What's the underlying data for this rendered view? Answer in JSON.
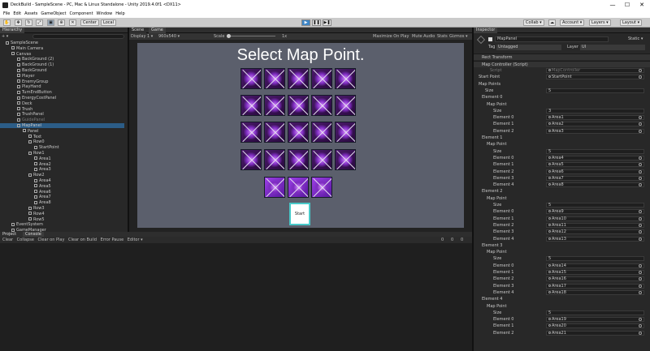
{
  "window": {
    "title": "DeckBuild - SampleScene - PC, Mac & Linux Standalone - Unity 2019.4.0f1 <DX11>",
    "controls": [
      "—",
      "☐",
      "✕"
    ]
  },
  "menu": [
    "File",
    "Edit",
    "Assets",
    "GameObject",
    "Component",
    "Window",
    "Help"
  ],
  "toolbar": {
    "pivot": "Center",
    "space": "Local",
    "collab": "Collab ▾",
    "account": "Account ▾",
    "layers": "Layers ▾",
    "layout": "Layout ▾"
  },
  "hierarchy": {
    "tab": "Hierarchy",
    "add": "+ ▾",
    "items": [
      {
        "label": "SampleScene",
        "indent": 1,
        "dim": false,
        "sel": false
      },
      {
        "label": "Main Camera",
        "indent": 2,
        "dim": false,
        "sel": false
      },
      {
        "label": "Canvas",
        "indent": 2,
        "dim": false,
        "sel": false
      },
      {
        "label": "BackGround (2)",
        "indent": 3,
        "dim": false,
        "sel": false
      },
      {
        "label": "BackGround (1)",
        "indent": 3,
        "dim": false,
        "sel": false
      },
      {
        "label": "BackGround",
        "indent": 3,
        "dim": false,
        "sel": false
      },
      {
        "label": "Player",
        "indent": 3,
        "dim": false,
        "sel": false
      },
      {
        "label": "EnemyGroup",
        "indent": 3,
        "dim": false,
        "sel": false
      },
      {
        "label": "PlayHand",
        "indent": 3,
        "dim": false,
        "sel": false
      },
      {
        "label": "TurnEndButton",
        "indent": 3,
        "dim": false,
        "sel": false
      },
      {
        "label": "EnergyCostPanel",
        "indent": 3,
        "dim": false,
        "sel": false
      },
      {
        "label": "Deck",
        "indent": 3,
        "dim": false,
        "sel": false
      },
      {
        "label": "Trush",
        "indent": 3,
        "dim": false,
        "sel": false
      },
      {
        "label": "TrushPanel",
        "indent": 3,
        "dim": false,
        "sel": false
      },
      {
        "label": "GuidePanel",
        "indent": 3,
        "dim": true,
        "sel": false
      },
      {
        "label": "MapPanel",
        "indent": 3,
        "dim": false,
        "sel": true
      },
      {
        "label": "Panel",
        "indent": 4,
        "dim": false,
        "sel": false
      },
      {
        "label": "Text",
        "indent": 5,
        "dim": false,
        "sel": false
      },
      {
        "label": "Row0",
        "indent": 5,
        "dim": false,
        "sel": false
      },
      {
        "label": "StartPoint",
        "indent": 6,
        "dim": false,
        "sel": false
      },
      {
        "label": "Row1",
        "indent": 5,
        "dim": false,
        "sel": false
      },
      {
        "label": "Area1",
        "indent": 6,
        "dim": false,
        "sel": false
      },
      {
        "label": "Area2",
        "indent": 6,
        "dim": false,
        "sel": false
      },
      {
        "label": "Area3",
        "indent": 6,
        "dim": false,
        "sel": false
      },
      {
        "label": "Row2",
        "indent": 5,
        "dim": false,
        "sel": false
      },
      {
        "label": "Area4",
        "indent": 6,
        "dim": false,
        "sel": false
      },
      {
        "label": "Area5",
        "indent": 6,
        "dim": false,
        "sel": false
      },
      {
        "label": "Area6",
        "indent": 6,
        "dim": false,
        "sel": false
      },
      {
        "label": "Area7",
        "indent": 6,
        "dim": false,
        "sel": false
      },
      {
        "label": "Area8",
        "indent": 6,
        "dim": false,
        "sel": false
      },
      {
        "label": "Row3",
        "indent": 5,
        "dim": false,
        "sel": false
      },
      {
        "label": "Row4",
        "indent": 5,
        "dim": false,
        "sel": false
      },
      {
        "label": "Row5",
        "indent": 5,
        "dim": false,
        "sel": false
      },
      {
        "label": "EventSystem",
        "indent": 2,
        "dim": false,
        "sel": false
      },
      {
        "label": "GameManager",
        "indent": 2,
        "dim": false,
        "sel": false
      }
    ]
  },
  "sceneTabs": {
    "scene": "Scene",
    "game": "Game"
  },
  "gameToolbar": {
    "display": "Display 1 ▾",
    "resolution": "960x540 ▾",
    "scale_label": "Scale",
    "scale_value": "1x",
    "maximize": "Maximize On Play",
    "mute": "Mute Audio",
    "stats": "Stats",
    "gizmos": "Gizmos ▾"
  },
  "game": {
    "title": "Select Map Point.",
    "start_button": "Start",
    "tile_rows": [
      5,
      5,
      5,
      5,
      3
    ]
  },
  "console": {
    "tabs": [
      "Project",
      "Console"
    ],
    "buttons": [
      "Clear",
      "Collapse",
      "Clear on Play",
      "Clear on Build",
      "Error Pause",
      "Editor ▾"
    ],
    "counts": [
      "0",
      "0",
      "0"
    ]
  },
  "inspector": {
    "tab": "Inspector",
    "object_name": "MapPanel",
    "static_label": "Static ▾",
    "tag_label": "Tag",
    "tag_value": "Untagged",
    "layer_label": "Layer",
    "layer_value": "UI",
    "rect_transform": "Rect Transform",
    "component": "Map Controller (Script)",
    "script_label": "Script",
    "script_value": "MapController",
    "start_point_label": "Start Point",
    "start_point_value": "StartPoint",
    "map_points_label": "Map Points",
    "size_label": "Size",
    "size_value": "5",
    "elements": [
      {
        "name": "Element 0",
        "size": "3",
        "items": [
          "Area1",
          "Area2",
          "Area3"
        ]
      },
      {
        "name": "Element 1",
        "size": "5",
        "items": [
          "Area4",
          "Area5",
          "Area6",
          "Area7",
          "Area8"
        ]
      },
      {
        "name": "Element 2",
        "size": "5",
        "items": [
          "Area9",
          "Area10",
          "Area11",
          "Area12",
          "Area13"
        ]
      },
      {
        "name": "Element 3",
        "size": "5",
        "items": [
          "Area14",
          "Area15",
          "Area16",
          "Area17",
          "Area18"
        ]
      },
      {
        "name": "Element 4",
        "size": "5",
        "items": [
          "Area19",
          "Area20",
          "Area21"
        ]
      }
    ],
    "map_point_label": "Map Point",
    "element_prefix": "Element "
  }
}
